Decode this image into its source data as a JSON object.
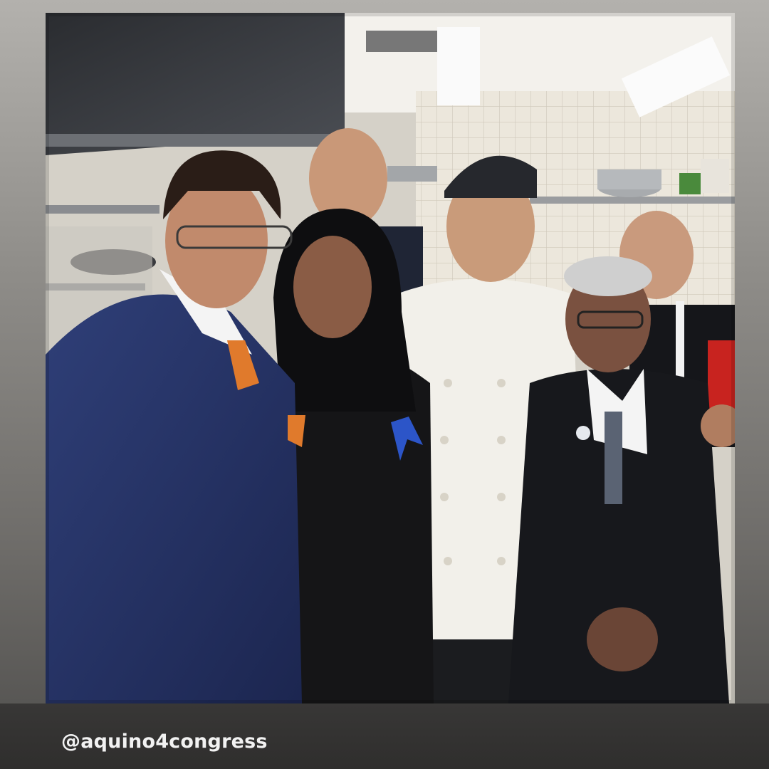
{
  "story": {
    "mention": "@aquino4congress",
    "photo": {
      "subject": "group-photo-in-restaurant-kitchen",
      "people_count": 6
    }
  },
  "colors": {
    "caption_bar": "#2f2e2d",
    "mention_text": "#f2f2f2"
  }
}
